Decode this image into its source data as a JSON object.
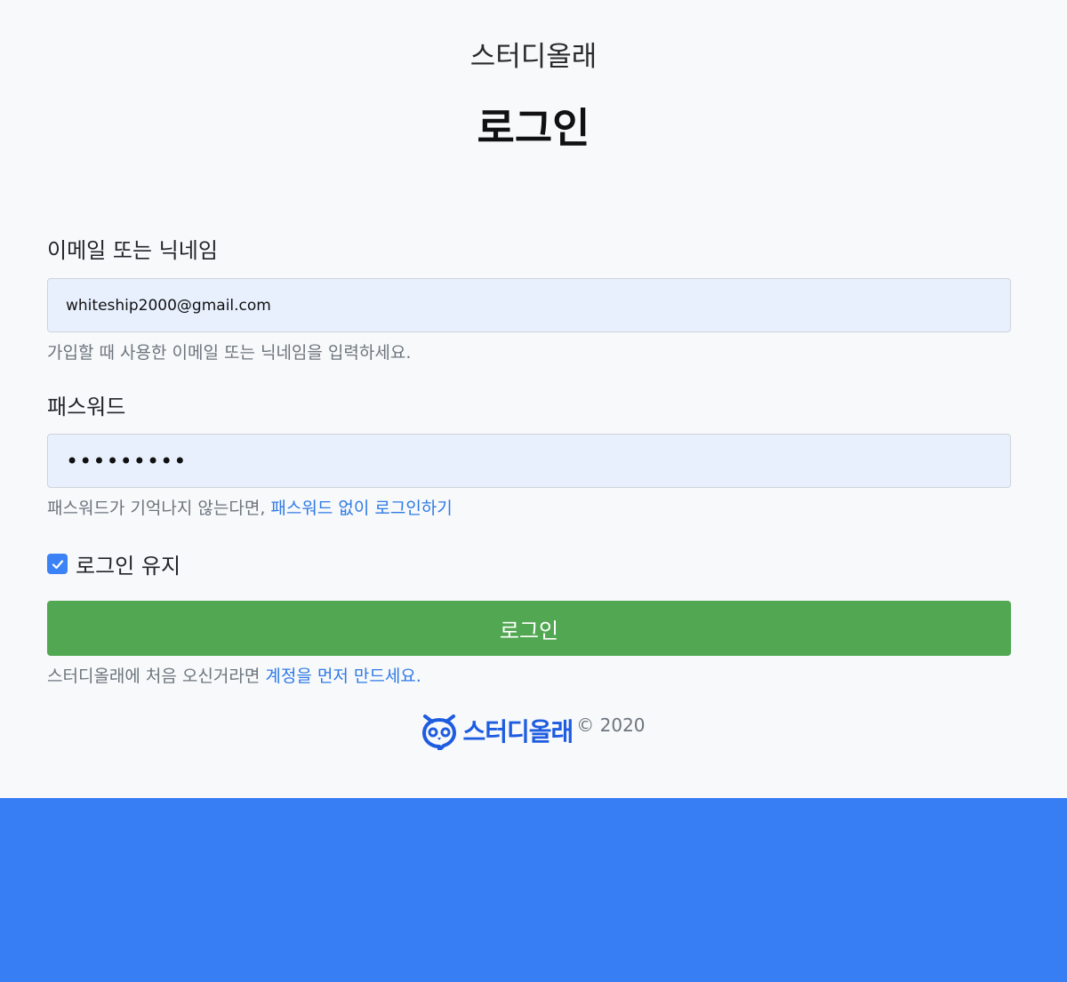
{
  "header": {
    "brand": "스터디올래",
    "title": "로그인"
  },
  "form": {
    "username_label": "이메일 또는 닉네임",
    "username_value": "whiteship2000@gmail.com",
    "username_help": "가입할 때 사용한 이메일 또는 닉네임을 입력하세요.",
    "password_label": "패스워드",
    "password_value": "•••••••••",
    "password_help_prefix": "패스워드가 기억나지 않는다면, ",
    "password_help_link": "패스워드 없이 로그인하기",
    "remember_label": "로그인 유지",
    "remember_checked": true,
    "submit_label": "로그인",
    "signup_prefix": "스터디올래에 처음 오신거라면 ",
    "signup_link": "계정을 먼저 만드세요."
  },
  "footer": {
    "logo_text": "스터디올래",
    "copyright": "© 2020"
  },
  "colors": {
    "accent": "#2f7ae5",
    "button": "#52a852",
    "input_bg": "#e8f0fe",
    "bottom_band": "#377ef5",
    "logo": "#1e5ce0"
  },
  "icons": {
    "checkbox": "check-icon",
    "logo": "owl-logo-icon"
  }
}
